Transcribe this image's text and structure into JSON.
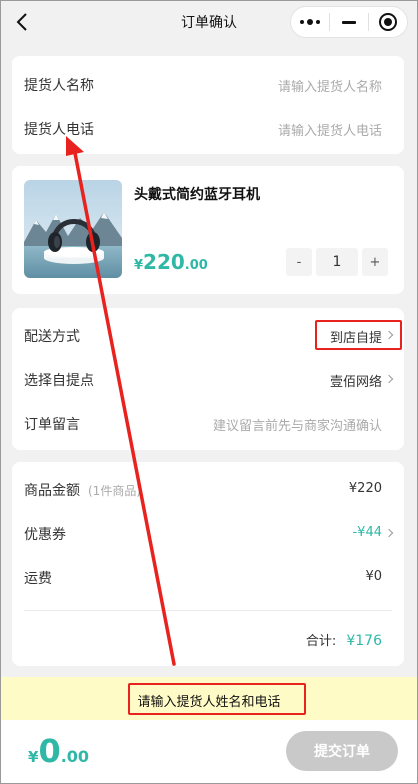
{
  "header": {
    "title": "订单确认"
  },
  "pickup": {
    "name_label": "提货人名称",
    "name_placeholder": "请输入提货人名称",
    "phone_label": "提货人电话",
    "phone_placeholder": "请输入提货人电话"
  },
  "product": {
    "name": "头戴式简约蓝牙耳机",
    "price_symbol": "¥",
    "price_int": "220",
    "price_dec": ".00",
    "qty": "1",
    "minus_label": "-",
    "plus_label": "+"
  },
  "delivery": {
    "method_label": "配送方式",
    "method_value": "到店自提",
    "point_label": "选择自提点",
    "point_value": "壹佰网络",
    "note_label": "订单留言",
    "note_placeholder": "建议留言前先与商家沟通确认"
  },
  "summary": {
    "goods_label": "商品金额",
    "goods_count": "(1件商品)",
    "goods_value": "¥220",
    "coupon_label": "优惠券",
    "coupon_value": "-¥44",
    "freight_label": "运费",
    "freight_value": "¥0",
    "total_label": "合计:",
    "total_value": "¥176"
  },
  "toast": {
    "message": "请输入提货人姓名和电话"
  },
  "footer": {
    "total_symbol": "¥",
    "total_int": "0",
    "total_dec": ".00",
    "submit_label": "提交订单"
  },
  "colors": {
    "accent": "#2fb8a6",
    "annotation": "#e8231f",
    "toast_bg": "#fffbc6",
    "submit_disabled": "#c9c9c9"
  }
}
